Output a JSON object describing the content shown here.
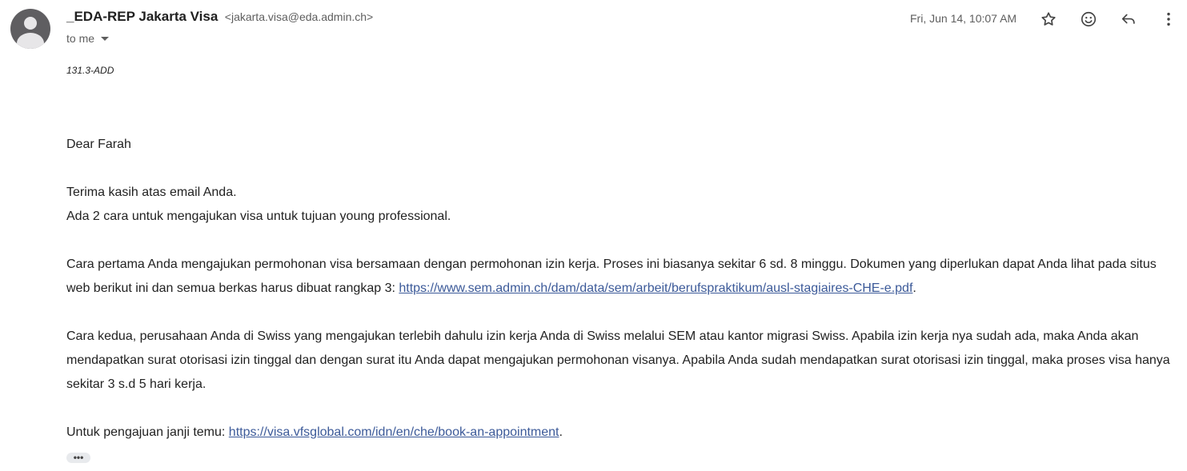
{
  "email": {
    "sender_name": "_EDA-REP Jakarta Visa",
    "sender_email": "<jakarta.visa@eda.admin.ch>",
    "recipient": "to me",
    "date": "Fri, Jun 14, 10:07 AM",
    "reference": "131.3-ADD",
    "greeting": "Dear Farah",
    "para1_line1": "Terima kasih atas email Anda.",
    "para1_line2": "Ada 2 cara untuk mengajukan visa untuk tujuan young professional.",
    "para2_text": "Cara pertama Anda mengajukan permohonan visa bersamaan dengan permohonan izin kerja. Proses ini biasanya sekitar 6 sd. 8 minggu. Dokumen yang diperlukan dapat Anda lihat pada situs web berikut ini dan semua berkas harus dibuat rangkap 3: ",
    "para2_link": "https://www.sem.admin.ch/dam/data/sem/arbeit/berufspraktikum/ausl-stagiaires-CHE-e.pdf",
    "para2_end": ".",
    "para3_text": "Cara kedua, perusahaan Anda di Swiss yang mengajukan terlebih dahulu izin kerja Anda di Swiss melalui SEM atau kantor migrasi Swiss. Apabila izin kerja nya sudah ada, maka Anda akan mendapatkan surat otorisasi izin tinggal dan dengan surat itu Anda dapat mengajukan permohonan visanya. Apabila Anda sudah mendapatkan surat otorisasi izin tinggal, maka proses visa hanya sekitar 3 s.d 5 hari kerja.",
    "para4_text": "Untuk pengajuan janji temu: ",
    "para4_link": "https://visa.vfsglobal.com/idn/en/che/book-an-appointment",
    "para4_end": ".",
    "trimmed_content_label": "•••"
  },
  "icons": {
    "star": "star-icon",
    "emoji": "emoji-icon",
    "reply": "reply-icon",
    "more": "more-vert-icon"
  },
  "colors": {
    "link": "#3c5a99",
    "avatar_bg": "#5f5e61"
  }
}
